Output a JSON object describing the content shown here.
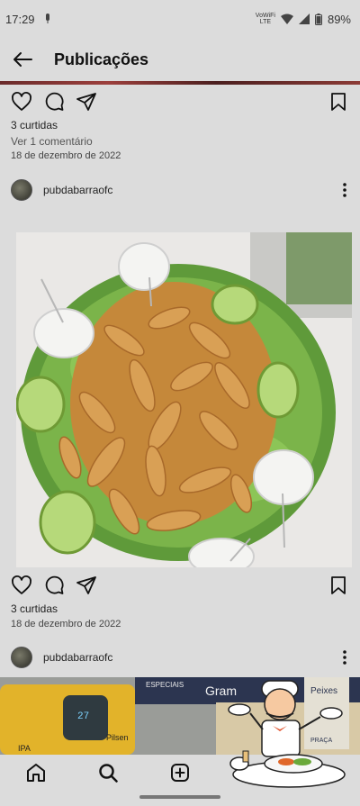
{
  "status": {
    "time": "17:29",
    "volte_top": "VoWiFi",
    "volte_bottom": "LTE",
    "battery": "89%"
  },
  "appbar": {
    "title": "Publicações"
  },
  "post1": {
    "likes": "3 curtidas",
    "comments": "Ver 1 comentário",
    "date": "18 de dezembro de 2022"
  },
  "post2": {
    "author": "pubdabarraofc",
    "likes": "3 curtidas",
    "date": "18 de dezembro de 2022"
  },
  "post3": {
    "author": "pubdabarraofc",
    "signs": [
      "ESPECIAIS",
      "Gram",
      "Peixes",
      "PRAÇA",
      "Pilsen",
      "IPA",
      "27"
    ]
  },
  "icons": [
    "arrow-left-icon",
    "heart-icon",
    "comment-icon",
    "send-icon",
    "bookmark-icon",
    "more-vertical-icon",
    "home-icon",
    "search-icon",
    "add-post-icon"
  ],
  "colors": {
    "background": "#dcdcdc",
    "text": "#111111"
  }
}
